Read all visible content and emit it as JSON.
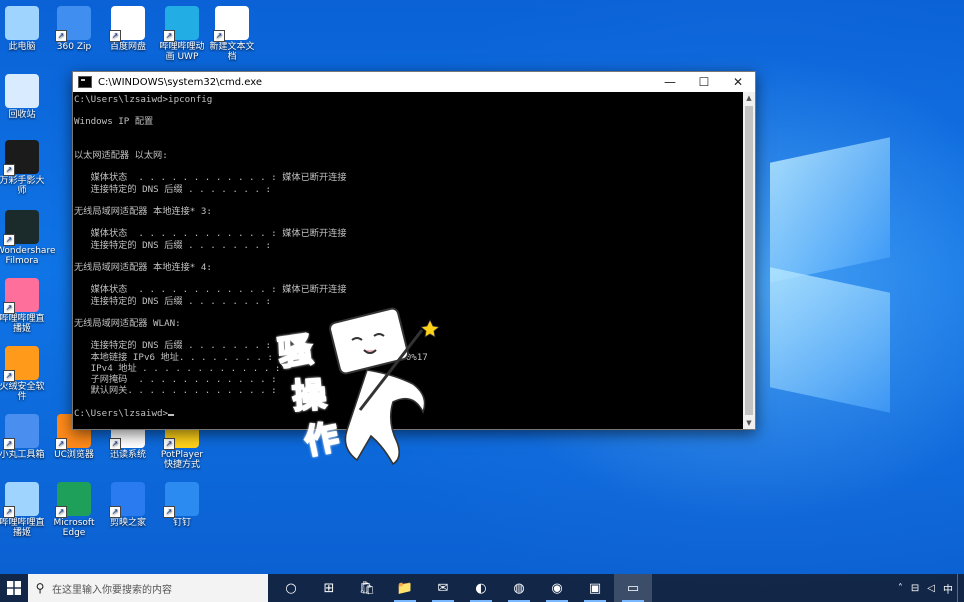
{
  "desktop": {
    "icons": [
      {
        "label": "此电脑",
        "icon": "computer-icon",
        "color": "#9fd4ff"
      },
      {
        "label": "360 Zip",
        "icon": "archive-icon",
        "color": "#3f8ef0"
      },
      {
        "label": "百度网盘",
        "icon": "cloud-icon",
        "color": "#ffffff"
      },
      {
        "label": "哔哩哔哩动画 UWP",
        "icon": "bilibili-icon",
        "color": "#23ade5"
      },
      {
        "label": "新建文本文档",
        "icon": "text-file-icon",
        "color": "#ffffff"
      },
      {
        "label": "回收站",
        "icon": "recycle-bin-icon",
        "color": "#d9ecff"
      },
      {
        "label": "万彩手影大师",
        "icon": "hm-icon",
        "color": "#1b1b1b"
      },
      {
        "label": "Wondershare Filmora",
        "icon": "filmora-icon",
        "color": "#1b2b2b"
      },
      {
        "label": "哔哩哔哩直播姬",
        "icon": "live-icon",
        "color": "#ff6f9c"
      },
      {
        "label": "火绒安全软件",
        "icon": "shield-icon",
        "color": "#ff9a1a"
      },
      {
        "label": "小丸工具箱",
        "icon": "toolbox-icon",
        "color": "#4a8ef0"
      },
      {
        "label": "UC浏览器",
        "icon": "uc-browser-icon",
        "color": "#ff8a1a"
      },
      {
        "label": "迅读系统",
        "icon": "app-icon",
        "color": "#ffffff"
      },
      {
        "label": "PotPlayer 快捷方式",
        "icon": "potplayer-icon",
        "color": "#ffd21a"
      },
      {
        "label": "哔哩哔哩直播姬",
        "icon": "live-icon",
        "color": "#9fd4ff"
      },
      {
        "label": "Microsoft Edge",
        "icon": "edge-icon",
        "color": "#1fa05a"
      },
      {
        "label": "剪映之家",
        "icon": "feather-icon",
        "color": "#2b7bf0"
      },
      {
        "label": "钉钉",
        "icon": "dingtalk-icon",
        "color": "#2b8bf0"
      }
    ]
  },
  "cmd_window": {
    "title": "C:\\WINDOWS\\system32\\cmd.exe",
    "controls": {
      "minimize": "—",
      "maximize": "☐",
      "close": "✕"
    },
    "lines": [
      "C:\\Users\\lzsaiwd>ipconfig",
      "",
      "Windows IP 配置",
      "",
      "",
      "以太网适配器 以太网:",
      "",
      "   媒体状态  . . . . . . . . . . . . : 媒体已断开连接",
      "   连接特定的 DNS 后缀 . . . . . . . :",
      "",
      "无线局域网适配器 本地连接* 3:",
      "",
      "   媒体状态  . . . . . . . . . . . . : 媒体已断开连接",
      "   连接特定的 DNS 后缀 . . . . . . . :",
      "",
      "无线局域网适配器 本地连接* 4:",
      "",
      "   媒体状态  . . . . . . . . . . . . : 媒体已断开连接",
      "   连接特定的 DNS 后缀 . . . . . . . :",
      "",
      "无线局域网适配器 WLAN:",
      "",
      "   连接特定的 DNS 后缀 . . . . . . . :",
      "   本地链接 IPv6 地址. . . . . . . . :                        0%17",
      "   IPv4 地址 . . . . . . . . . . . . :",
      "   子网掩码  . . . . . . . . . . . . :",
      "   默认网关. . . . . . . . . . . . . :",
      "",
      "C:\\Users\\lzsaiwd>"
    ]
  },
  "sticker": {
    "characters": [
      "骚",
      "操",
      "作"
    ]
  },
  "taskbar": {
    "search_placeholder": "在这里输入你要搜索的内容",
    "items": [
      {
        "name": "task-view",
        "glyph": "○"
      },
      {
        "name": "widgets",
        "glyph": "⊞"
      },
      {
        "name": "store",
        "glyph": "🛍"
      },
      {
        "name": "file-explorer",
        "glyph": "📁"
      },
      {
        "name": "mail",
        "glyph": "✉"
      },
      {
        "name": "browser",
        "glyph": "◐"
      },
      {
        "name": "edge",
        "glyph": "◍"
      },
      {
        "name": "app-1",
        "glyph": "◉"
      },
      {
        "name": "app-2",
        "glyph": "▣"
      },
      {
        "name": "cmd",
        "glyph": "▭"
      }
    ],
    "tray": {
      "chevron": "˄",
      "network": "⊟",
      "volume": "◁",
      "ime": "中"
    }
  }
}
